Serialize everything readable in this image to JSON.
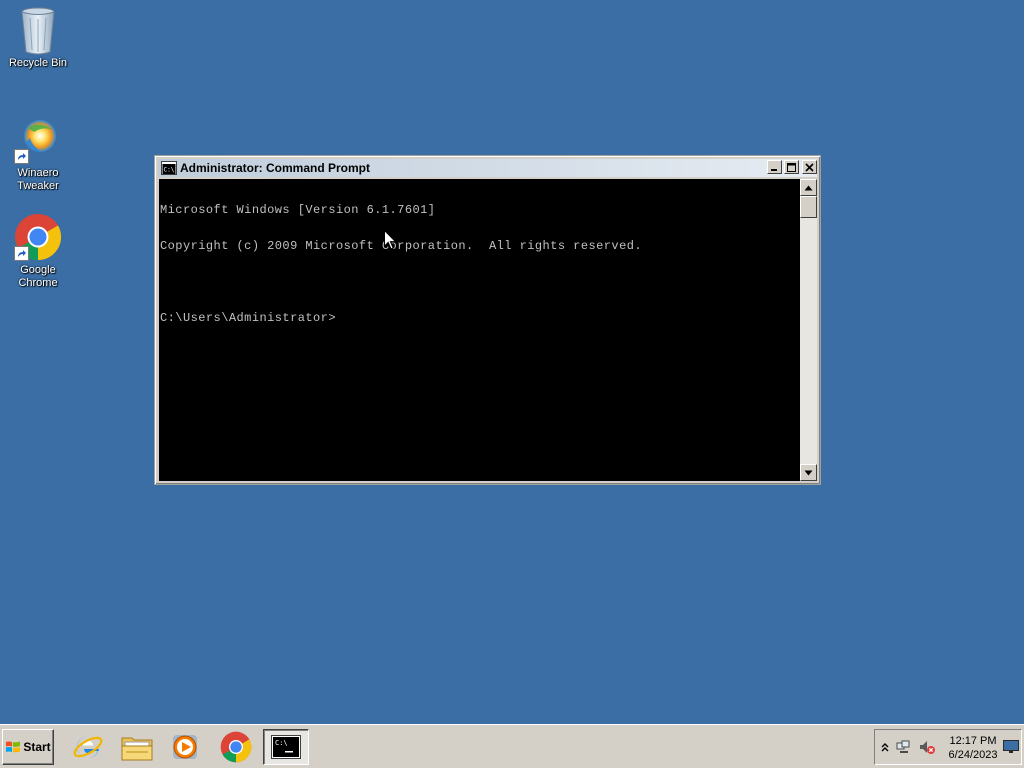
{
  "desktop": {
    "icons": [
      {
        "label": "Recycle Bin"
      },
      {
        "label": "Winaero\nTweaker"
      },
      {
        "label": "Google Chrome"
      }
    ],
    "background_color": "#3a6ea5"
  },
  "window": {
    "title": "Administrator: Command Prompt",
    "console_lines": [
      "Microsoft Windows [Version 6.1.7601]",
      "Copyright (c) 2009 Microsoft Corporation.  All rights reserved.",
      "",
      "C:\\Users\\Administrator>"
    ],
    "console_background": "#000000",
    "console_text_color": "#c0c0c0"
  },
  "taskbar": {
    "start_label": "Start",
    "pinned": [
      {
        "icon": "internet-explorer-icon"
      },
      {
        "icon": "folder-icon"
      },
      {
        "icon": "media-player-icon"
      },
      {
        "icon": "chrome-icon"
      },
      {
        "icon": "command-prompt-icon",
        "active": true
      }
    ],
    "tray": {
      "time": "12:17 PM",
      "date": "6/24/2023"
    }
  }
}
